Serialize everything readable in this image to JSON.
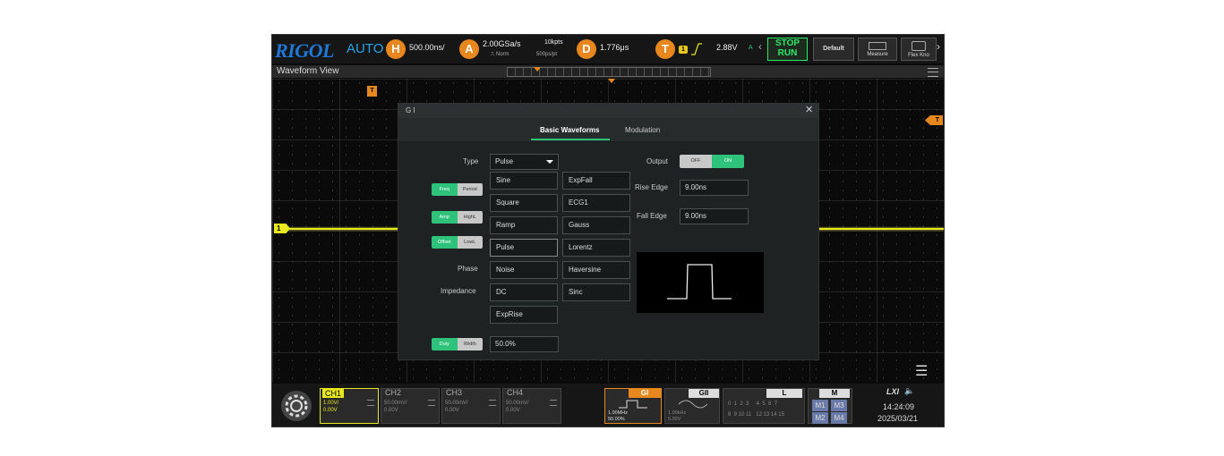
{
  "topbar": {
    "logo": "RIGOL",
    "mode": "AUTO",
    "h_label": "H",
    "h_value": "500.00ns/",
    "a_label": "A",
    "sample_rate": "2.00GSa/s",
    "acq_mode": "Norm",
    "mem_depth": "10kpts",
    "sample_interval": "500ps/pt",
    "d_label": "D",
    "d_value": "1.776μs",
    "t_label": "T",
    "trig_source": "1",
    "trig_level": "2.88V",
    "trig_mode": "A",
    "stop_label": "STOP",
    "run_label": "RUN",
    "default_label": "Default",
    "measure_label": "Measure",
    "flexknob_label": "Flex Kno"
  },
  "view": {
    "title": "Waveform View",
    "ch1_marker": "1",
    "trigger_marker": "T",
    "trigger_level_marker": "T"
  },
  "dialog": {
    "title": "G I",
    "tabs": [
      "Basic Waveforms",
      "Modulation"
    ],
    "type_label": "Type",
    "type_value": "Pulse",
    "freq_toggle": [
      "Freq",
      "Period"
    ],
    "amp_toggle": [
      "Amp",
      "HighL"
    ],
    "offset_toggle": [
      "Offset",
      "LowL"
    ],
    "phase_label": "Phase",
    "impedance_label": "Impedance",
    "duty_toggle": [
      "Duty",
      "Width"
    ],
    "duty_value": "50.0%",
    "waveforms_col1": [
      "Sine",
      "Square",
      "Ramp",
      "Pulse",
      "Noise",
      "DC",
      "ExpRise"
    ],
    "waveforms_col2": [
      "ExpFall",
      "ECG1",
      "Gauss",
      "Lorentz",
      "Haversine",
      "Sinc"
    ],
    "output_label": "Output",
    "output_off": "OFF",
    "output_on": "ON",
    "rise_edge_label": "Rise Edge",
    "rise_edge_value": "9.00ns",
    "fall_edge_label": "Fall Edge",
    "fall_edge_value": "9.00ns"
  },
  "bottombar": {
    "channels": [
      {
        "name": "CH1",
        "scale": "1.00V/",
        "offset": "0.00V"
      },
      {
        "name": "CH2",
        "scale": "50.00mV/",
        "offset": "0.00V"
      },
      {
        "name": "CH3",
        "scale": "50.00mV/",
        "offset": "0.00V"
      },
      {
        "name": "CH4",
        "scale": "50.00mV/",
        "offset": "0.00V"
      }
    ],
    "gi": {
      "title": "GI",
      "freq": "1.00MHz",
      "duty": "50.00%"
    },
    "gii": {
      "title": "GII",
      "freq": "1.00kHz",
      "amp": "5.00V"
    },
    "logic": {
      "title": "L",
      "row1": "0  1  2  3     4  5  6  7",
      "row2": "8  9 10 11   12 13 14 15"
    },
    "math": {
      "title": "M",
      "buttons": [
        "M1",
        "M3",
        "M2",
        "M4"
      ]
    },
    "lxi": "LXI",
    "time": "14:24:09",
    "date": "2025/03/21"
  },
  "colors": {
    "ch1": "#e8e81e",
    "trigger": "#e8871e",
    "accent": "#2ec27a",
    "logo": "#1f78d8"
  }
}
